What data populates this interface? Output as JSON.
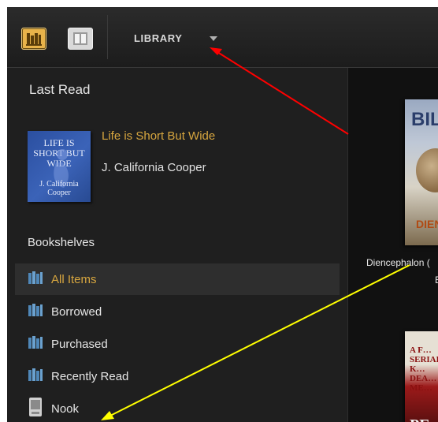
{
  "toolbar": {
    "title": "LIBRARY",
    "library_view_icon": "bookshelf-icon",
    "reading_view_icon": "open-book-icon",
    "dropdown_icon": "caret-down-icon",
    "accent_color": "#e8b34a"
  },
  "sidebar": {
    "last_read_heading": "Last Read",
    "last_read": {
      "cover_title": "LIFE IS SHORT BUT WIDE",
      "cover_author": "J. California Cooper",
      "title": "Life is Short But Wide",
      "author": "J. California Cooper"
    },
    "bookshelves_heading": "Bookshelves",
    "items": [
      {
        "label": "All Items",
        "icon": "bookshelf-icon"
      },
      {
        "label": "Borrowed",
        "icon": "bookshelf-icon"
      },
      {
        "label": "Purchased",
        "icon": "bookshelf-icon"
      },
      {
        "label": "Recently Read",
        "icon": "bookshelf-icon"
      },
      {
        "label": "Nook",
        "icon": "nook-device-icon"
      }
    ]
  },
  "content": {
    "book1": {
      "cover_word": "BIL",
      "cover_word2": "DIEN",
      "caption_line1": "Diencephalon (",
      "caption_line2": "B"
    },
    "book2": {
      "cover_text": "A F… SERIAL K… DEA… ME…",
      "cover_bottom": "PE"
    }
  }
}
